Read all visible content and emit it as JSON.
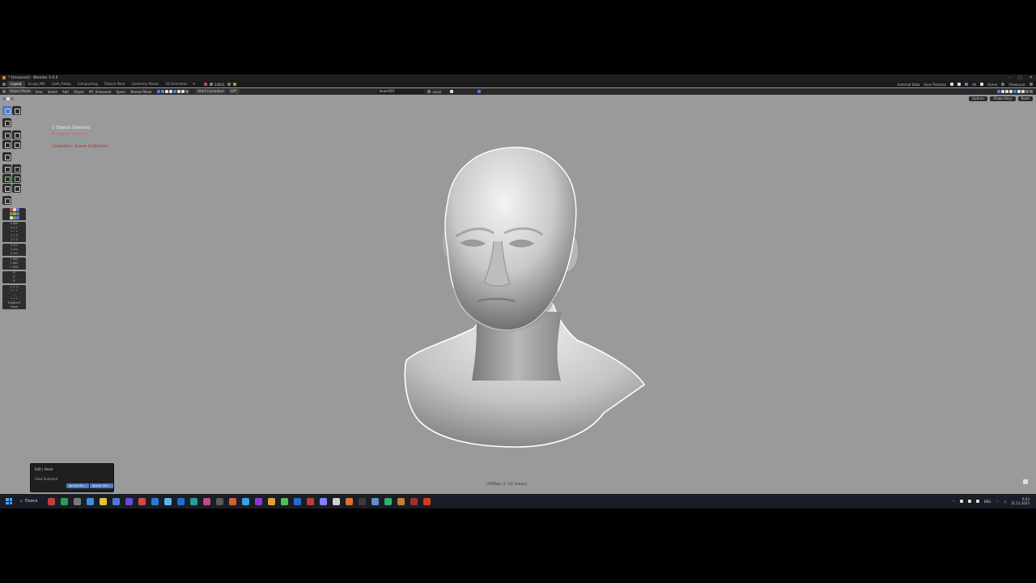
{
  "window": {
    "title": "* [Unsaved] - Blender 5.0.0",
    "controls": [
      "–",
      "□",
      "✕"
    ]
  },
  "workspaces": {
    "tabs": [
      "Layout",
      "Sculpt_MH",
      "Cloth_Retop",
      "Compositing",
      "Texture Paint",
      "Geometry Nodes",
      "2D Animation"
    ],
    "active_index": 0,
    "frame": "24002",
    "right": {
      "external_data": "External Data",
      "save_textures": "Save Textures",
      "scene": "Scene",
      "view_layer": "ViewLayer",
      "all": "All"
    }
  },
  "header": {
    "mode": "Object Mode",
    "menus": [
      "View",
      "Select",
      "Add",
      "Object",
      "MY_Sidepanel",
      "Specs",
      "Named Mesh"
    ],
    "start_cascadeur": "Start Cascadeur",
    "gpt": "GPT",
    "object_name": "head.001",
    "transform_orientation": "Local"
  },
  "header2": {
    "options": "Options",
    "shape_keys": "Shape Keys",
    "nodes": "Node"
  },
  "toolbar": {
    "panel_values_1": [
      "0.000"
    ],
    "panel_values_2": [
      "0 cm",
      "0 cm",
      "0 cm"
    ],
    "panel_values_3": [
      "1.000",
      "1.000",
      "1.000"
    ],
    "panel_values_4": [
      "0°",
      "0°",
      "0°"
    ],
    "gradient": "Gradient",
    "edge": "Edge"
  },
  "overlay": {
    "selected": "1 Objects Selected",
    "triangles": "Triangles: 48,004",
    "mesh": "Mesh: head.001",
    "collection": "Collection: Scene Collection"
  },
  "operator_panel": {
    "title": "Edit | Head",
    "subtitle": "View Selected",
    "buttons": [
      "Ignore Mirr...",
      "Ignore Arm..."
    ]
  },
  "status": {
    "uvmap": "UVMap (1 UV maps)"
  },
  "taskbar": {
    "search": "Поиск",
    "lang": "ENG",
    "time": "9:43",
    "date": "31.12.2025",
    "app_colors": [
      "#c04040",
      "#2a9d5a",
      "#7a7a7a",
      "#3c8dde",
      "#e6c23a",
      "#4a7bd6",
      "#6a4ad6",
      "#d04a4a",
      "#2a7bd6",
      "#58b8e8",
      "#1f6fd0",
      "#2a9aa0",
      "#c04a8a",
      "#5a5a5a",
      "#d06030",
      "#3aa0e0",
      "#8a3ad0",
      "#e0a030",
      "#5aba5a",
      "#2a6ad0",
      "#c03a3a",
      "#8080ff",
      "#d0d0d0",
      "#e07030",
      "#3a3a3a",
      "#6090c0",
      "#30b070",
      "#c08030",
      "#a03030",
      "#d04020"
    ]
  }
}
